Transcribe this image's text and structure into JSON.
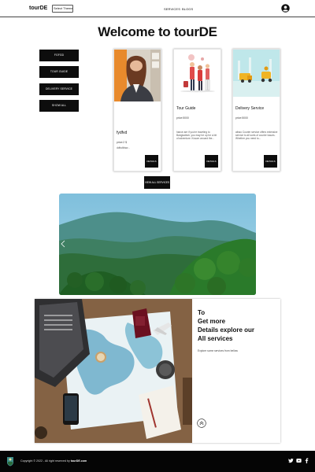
{
  "header": {
    "brand": "tourDE",
    "theme_select": "Select Theme",
    "nav": {
      "services": "SERVICES",
      "blogs": "BLOGS"
    }
  },
  "main": {
    "title": "Welcome to tourDE",
    "filters": [
      "FGFGD",
      "TOUR GUIDE",
      "DELIVERY SERVICE",
      "SHOW ALL"
    ],
    "cards": [
      {
        "title": "fydfvd",
        "price": "price:2 $",
        "desc": "ddfsdfdsw...",
        "button": "DETAILS"
      },
      {
        "title": "Tour Guide",
        "price": "price:5000",
        "desc": "hance are if you're traveling to Bangladesh, you may be up for a bit of adventure. Known around the...",
        "button": "DETAILS"
      },
      {
        "title": "Delivery Service",
        "price": "price:5000",
        "desc": "athao Courier service offers extensive service to all sorts of courier issues. Whether you need to...",
        "button": "DETAILS"
      }
    ],
    "view_all": "VIEW ALL SERVICES"
  },
  "feature": {
    "heading_lines": [
      "To",
      "Get more",
      "Details explore our",
      "All services"
    ],
    "subtext": "Explore some services from bellow"
  },
  "footer": {
    "copyright_prefix": "Copyright © 2022 - All right reserved by",
    "copyright_brand": "tourDE.com"
  },
  "icons": {
    "avatar": "user-circle-icon",
    "banner_prev": "chevron-left-icon",
    "scroll_up": "chevron-up-icon",
    "social": [
      "twitter-icon",
      "youtube-icon",
      "facebook-icon"
    ]
  }
}
